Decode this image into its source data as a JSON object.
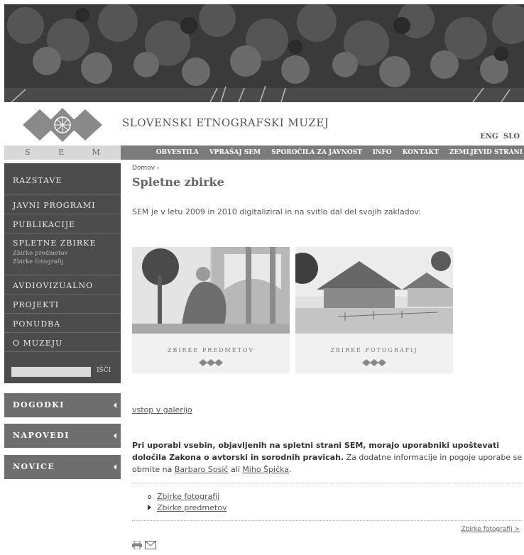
{
  "site": {
    "title": "SLOVENSKI ETNOGRAFSKI MUZEJ",
    "short": "S E M",
    "lang": [
      "ENG",
      "SLO"
    ]
  },
  "topnav": [
    "OBVESTILA",
    "VPRAŠAJ SEM",
    "SPOROČILA ZA JAVNOST",
    "INFO",
    "KONTAKT",
    "ZEMLJEVID STRANI"
  ],
  "sidebar": {
    "items": [
      {
        "label": "RAZSTAVE"
      },
      {
        "label": "JAVNI PROGRAMI"
      },
      {
        "label": "PUBLIKACIJE"
      },
      {
        "label": "SPLETNE ZBIRKE",
        "sub": [
          "Zbirke predmetov",
          "Zbirke fotografij"
        ]
      },
      {
        "label": "AVDIOVIZUALNO"
      },
      {
        "label": "PROJEKTI"
      },
      {
        "label": "PONUDBA"
      },
      {
        "label": "O MUZEJU"
      }
    ],
    "search_button": "IŠČI",
    "blocks": [
      "DOGODKI",
      "NAPOVEDI",
      "NOVICE"
    ]
  },
  "main": {
    "breadcrumb": "Domov",
    "title": "Spletne zbirke",
    "intro": "SEM je v letu 2009 in 2010 digitaliziral in na svitlo dal del svojih zakladov:",
    "galleries": [
      "ZBIRKE PREDMETOV",
      "ZBIRKE FOTOGRAFIJ"
    ],
    "gallery_link": "vstop v galerijo",
    "notice": {
      "bold": "Pri uporabi vsebin, objavljenih na spletni strani SEM, morajo uporabniki upoštevati določila Zakona o avtorski in sorodnih pravicah.",
      "text1": " Za dodatne informacije in pogoje uporabe se obrnite na ",
      "contact1": "Barbaro Sosič",
      "text2": " ali ",
      "contact2": "Miho Špička",
      "text3": "."
    },
    "sub_links": [
      "Zbirke fotografij",
      "Zbirke predmetov"
    ],
    "next_link": "Zbirke fotografij >"
  },
  "icons": [
    "print-icon",
    "email-icon"
  ]
}
